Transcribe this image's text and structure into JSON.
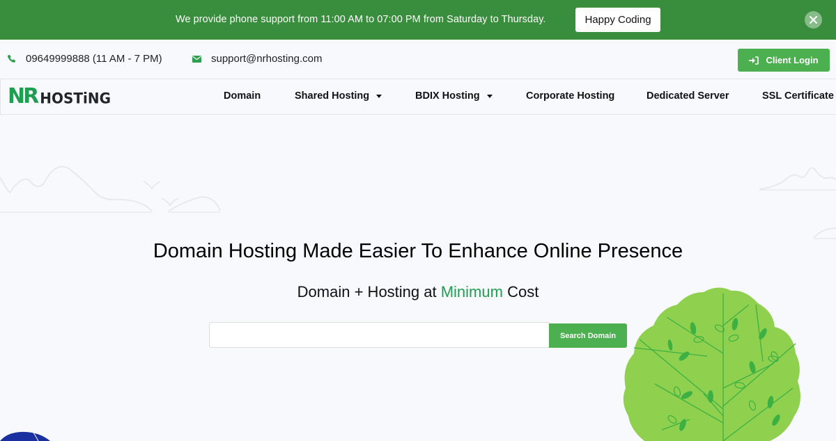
{
  "announcement": {
    "text": "We provide phone support from 11:00 AM to 07:00 PM from Saturday to Thursday.",
    "button_label": "Happy Coding",
    "close_icon": "close-icon"
  },
  "topbar": {
    "phone": "09649999888 (11 AM - 7 PM)",
    "phone_icon": "phone-icon",
    "email": "support@nrhosting.com",
    "email_icon": "envelope-icon",
    "login_label": "Client Login",
    "login_icon": "sign-in-icon"
  },
  "logo": {
    "part1": "NR",
    "part2": "HOSTiNG"
  },
  "nav": {
    "items": [
      {
        "label": "Domain",
        "dropdown": false
      },
      {
        "label": "Shared Hosting",
        "dropdown": true
      },
      {
        "label": "BDIX Hosting",
        "dropdown": true
      },
      {
        "label": "Corporate Hosting",
        "dropdown": false
      },
      {
        "label": "Dedicated Server",
        "dropdown": false
      },
      {
        "label": "SSL Certificate",
        "dropdown": false
      }
    ]
  },
  "hero": {
    "title": "Domain Hosting Made Easier To Enhance Online Presence",
    "subtitle_pre": "Domain + Hosting at ",
    "subtitle_highlight": "Minimum",
    "subtitle_post": " Cost",
    "search_value": "",
    "search_placeholder": "",
    "search_button": "Search Domain"
  },
  "colors": {
    "brand_green": "#388e3c",
    "button_green": "#4caf50",
    "highlight_green": "#1e9e50",
    "tree_green": "#8fd14f"
  }
}
